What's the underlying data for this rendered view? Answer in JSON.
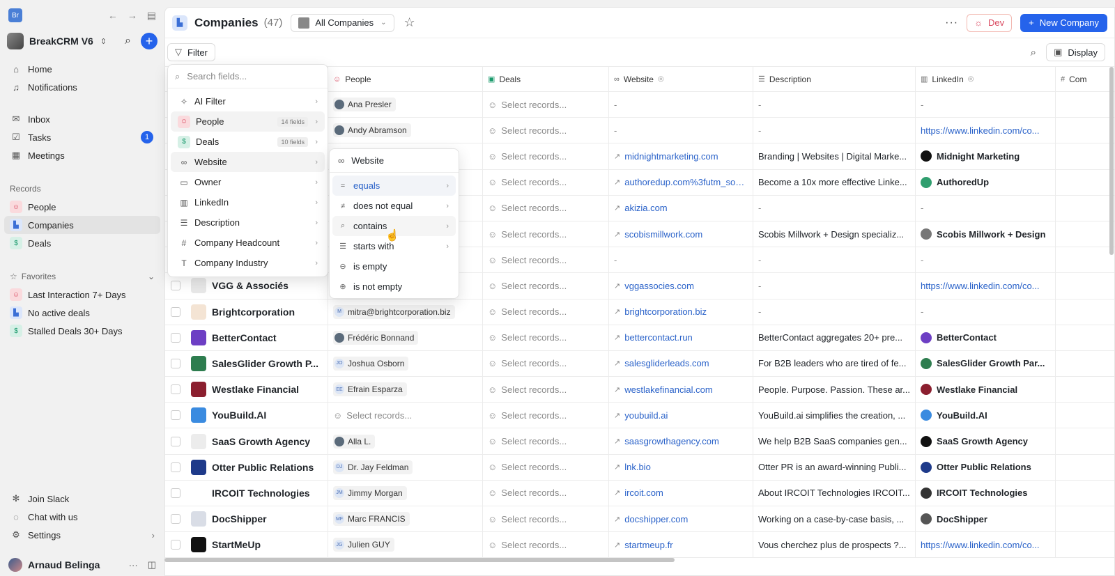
{
  "app": {
    "logo_text": "Br",
    "workspace": "BreakCRM V6"
  },
  "nav_main": [
    {
      "label": "Home",
      "icon": "home-icon",
      "glyph": "⌂"
    },
    {
      "label": "Notifications",
      "icon": "bell-icon",
      "glyph": "♫"
    }
  ],
  "nav_work": [
    {
      "label": "Inbox",
      "icon": "inbox-icon",
      "glyph": "✉"
    },
    {
      "label": "Tasks",
      "icon": "tasks-icon",
      "glyph": "☑",
      "badge": "1"
    },
    {
      "label": "Meetings",
      "icon": "calendar-icon",
      "glyph": "▦"
    }
  ],
  "records_label": "Records",
  "records": [
    {
      "label": "People",
      "icon": "people-icon"
    },
    {
      "label": "Companies",
      "icon": "companies-icon"
    },
    {
      "label": "Deals",
      "icon": "deals-icon"
    }
  ],
  "favorites_label": "Favorites",
  "favorites": [
    {
      "label": "Last Interaction 7+ Days"
    },
    {
      "label": "No active deals"
    },
    {
      "label": "Stalled Deals 30+ Days"
    }
  ],
  "bottom_nav": [
    {
      "label": "Join Slack",
      "icon": "slack-icon"
    },
    {
      "label": "Chat with us",
      "icon": "chat-icon"
    },
    {
      "label": "Settings",
      "icon": "gear-icon"
    }
  ],
  "user": {
    "name": "Arnaud Belinga"
  },
  "header": {
    "title": "Companies",
    "count": "(47)",
    "view": "All Companies",
    "more": "···",
    "dev": "Dev",
    "new": "New Company"
  },
  "toolbar": {
    "filter": "Filter",
    "display": "Display"
  },
  "columns": {
    "people": "People",
    "deals": "Deals",
    "website": "Website",
    "description": "Description",
    "linkedin": "LinkedIn",
    "com": "Com"
  },
  "select_records": "Select records...",
  "rows": [
    {
      "name": "",
      "person": "Ana Presler",
      "person_type": "photo",
      "website": "-",
      "desc": "-",
      "linkedin": "-",
      "linkedin_type": "dash"
    },
    {
      "name": "",
      "person": "Andy Abramson",
      "person_type": "photo",
      "website": "-",
      "desc": "-",
      "linkedin": "https://www.linkedin.com/co...",
      "linkedin_type": "link"
    },
    {
      "name": "",
      "person": "",
      "person_type": "none",
      "website": "midnightmarketing.com",
      "desc": "Branding | Websites | Digital Marke...",
      "linkedin": "Midnight Marketing",
      "linkedin_type": "company",
      "li_color": "#111"
    },
    {
      "name": "",
      "person": "",
      "person_type": "none",
      "website": "authoredup.com%3futm_sou...",
      "desc": "Become a 10x more effective Linke...",
      "linkedin": "AuthoredUp",
      "linkedin_type": "company",
      "li_color": "#2f9e6e"
    },
    {
      "name": "",
      "person": "",
      "person_type": "none",
      "website": "akizia.com",
      "desc": "-",
      "linkedin": "-",
      "linkedin_type": "dash"
    },
    {
      "name": "",
      "person": "",
      "person_type": "none",
      "website": "scobismillwork.com",
      "desc": "Scobis Millwork + Design specializ...",
      "linkedin": "Scobis Millwork + Design",
      "linkedin_type": "company",
      "li_color": "#777"
    },
    {
      "name": "",
      "person": "",
      "person_type": "none",
      "website": "-",
      "desc": "-",
      "linkedin": "-",
      "linkedin_type": "dash"
    },
    {
      "name": "VGG & Associés",
      "logo": "#e8e8e8",
      "person": "",
      "person_type": "none",
      "website": "vggassocies.com",
      "desc": "-",
      "linkedin": "https://www.linkedin.com/co...",
      "linkedin_type": "link"
    },
    {
      "name": "Brightcorporation",
      "logo": "#f4e4d4",
      "person": "mitra@brightcorporation.biz",
      "person_type": "initials",
      "initials": "M",
      "website": "brightcorporation.biz",
      "desc": "-",
      "linkedin": "-",
      "linkedin_type": "dash"
    },
    {
      "name": "BetterContact",
      "logo": "#6d3fc4",
      "person": "Frédéric Bonnand",
      "person_type": "photo",
      "website": "bettercontact.run",
      "desc": "BetterContact aggregates 20+ pre...",
      "linkedin": "BetterContact",
      "linkedin_type": "company",
      "li_color": "#6d3fc4"
    },
    {
      "name": "SalesGlider Growth P...",
      "logo": "#2e7d4f",
      "person": "Joshua Osborn",
      "person_type": "initials",
      "initials": "JO",
      "website": "salesgliderleads.com",
      "desc": "For B2B leaders who are tired of fe...",
      "linkedin": "SalesGlider Growth Par...",
      "linkedin_type": "company",
      "li_color": "#2e7d4f"
    },
    {
      "name": "Westlake Financial",
      "logo": "#8b1f2f",
      "person": "Efrain Esparza",
      "person_type": "initials",
      "initials": "EE",
      "website": "westlakefinancial.com",
      "desc": "People. Purpose. Passion. These ar...",
      "linkedin": "Westlake Financial",
      "linkedin_type": "company",
      "li_color": "#8b1f2f"
    },
    {
      "name": "YouBuild.AI",
      "logo": "#3a8be0",
      "person": "",
      "person_type": "select",
      "website": "youbuild.ai",
      "desc": "YouBuild.ai simplifies the creation, ...",
      "linkedin": "YouBuild.AI",
      "linkedin_type": "company",
      "li_color": "#3a8be0"
    },
    {
      "name": "SaaS Growth Agency",
      "logo": "#ececec",
      "person": "Alla L.",
      "person_type": "photo",
      "website": "saasgrowthagency.com",
      "desc": "We help B2B SaaS companies gen...",
      "linkedin": "SaaS Growth Agency",
      "linkedin_type": "company",
      "li_color": "#111"
    },
    {
      "name": "Otter Public Relations",
      "logo": "#1e3a8a",
      "person": "Dr. Jay Feldman",
      "person_type": "initials",
      "initials": "DJ",
      "website": "lnk.bio",
      "desc": "Otter PR is an award-winning Publi...",
      "linkedin": "Otter Public Relations",
      "linkedin_type": "company",
      "li_color": "#1e3a8a"
    },
    {
      "name": "IRCOIT Technologies",
      "logo": "#ffffff",
      "person": "Jimmy Morgan",
      "person_type": "initials",
      "initials": "JM",
      "website": "ircoit.com",
      "desc": "About IRCOIT Technologies IRCOIT...",
      "linkedin": "IRCOIT Technologies",
      "linkedin_type": "company",
      "li_color": "#333"
    },
    {
      "name": "DocShipper",
      "logo": "#d9dde6",
      "person": "Marc FRANCIS",
      "person_type": "initials",
      "initials": "MF",
      "website": "docshipper.com",
      "desc": "Working on a case-by-case basis, ...",
      "linkedin": "DocShipper",
      "linkedin_type": "company",
      "li_color": "#555"
    },
    {
      "name": "StartMeUp",
      "logo": "#111111",
      "person": "Julien GUY",
      "person_type": "initials",
      "initials": "JG",
      "website": "startmeup.fr",
      "desc": "Vous cherchez plus de prospects ?...",
      "linkedin": "https://www.linkedin.com/co...",
      "linkedin_type": "link"
    }
  ],
  "filter_menu": {
    "search_placeholder": "Search fields...",
    "items": [
      {
        "label": "AI Filter",
        "icon": "sparkle-icon",
        "glyph": "✧"
      },
      {
        "label": "People",
        "icon": "people-icon",
        "glyph": "☺",
        "count": "14 fields",
        "highlight": true
      },
      {
        "label": "Deals",
        "icon": "deals-icon",
        "glyph": "$",
        "count": "10 fields"
      },
      {
        "label": "Website",
        "icon": "link-icon",
        "glyph": "∞",
        "highlight": true
      },
      {
        "label": "Owner",
        "icon": "owner-icon",
        "glyph": "▭"
      },
      {
        "label": "LinkedIn",
        "icon": "linkedin-icon",
        "glyph": "▥"
      },
      {
        "label": "Description",
        "icon": "text-icon",
        "glyph": "☰"
      },
      {
        "label": "Company Headcount",
        "icon": "hash-icon",
        "glyph": "#"
      },
      {
        "label": "Company Industry",
        "icon": "type-icon",
        "glyph": "T"
      }
    ]
  },
  "operator_menu": {
    "field": "Website",
    "items": [
      {
        "label": "equals",
        "glyph": "=",
        "icon": "equals-icon",
        "chev": true,
        "selected": true
      },
      {
        "label": "does not equal",
        "glyph": "≠",
        "icon": "not-equal-icon",
        "chev": true
      },
      {
        "label": "contains",
        "glyph": "⌕",
        "icon": "contains-icon",
        "chev": true,
        "hover": true
      },
      {
        "label": "starts with",
        "glyph": "☰",
        "icon": "starts-with-icon",
        "chev": true
      },
      {
        "label": "is empty",
        "glyph": "⊖",
        "icon": "empty-icon",
        "chev": false
      },
      {
        "label": "is not empty",
        "glyph": "⊕",
        "icon": "not-empty-icon",
        "chev": false
      }
    ]
  }
}
